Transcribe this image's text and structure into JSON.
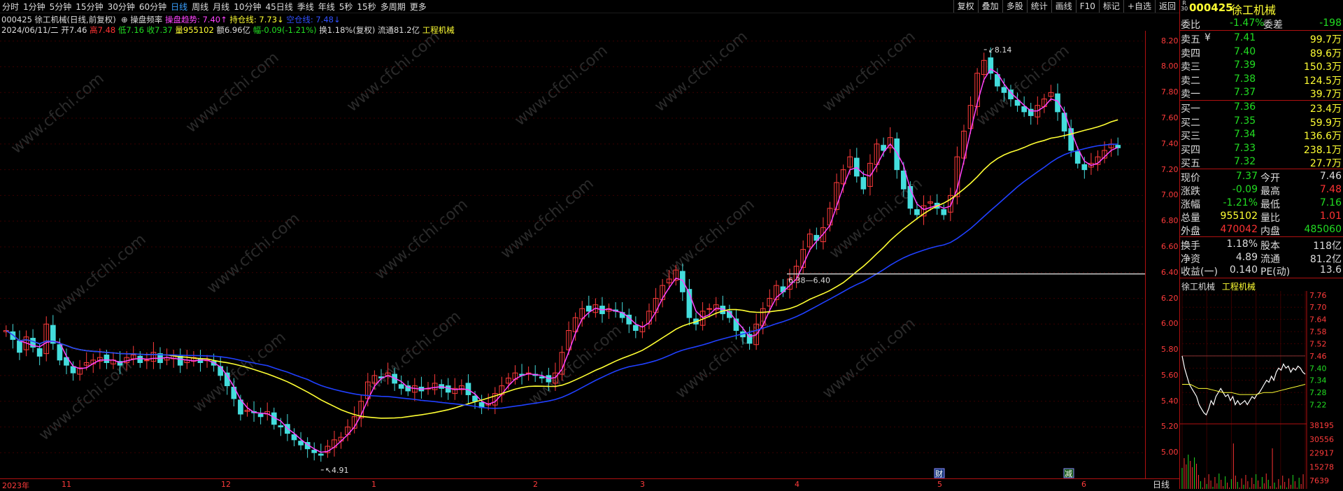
{
  "toolbar": {
    "timeframes": [
      "分时",
      "1分钟",
      "5分钟",
      "15分钟",
      "30分钟",
      "60分钟",
      "日线",
      "周线",
      "月线",
      "10分钟",
      "45日线",
      "季线",
      "年线",
      "5秒",
      "15秒",
      "多周期",
      "更多"
    ],
    "active": "日线",
    "tools": [
      "复权",
      "叠加",
      "多股",
      "统计",
      "画线",
      "F10",
      "标记",
      "+自选",
      "返回"
    ]
  },
  "info": {
    "line1": {
      "code_name": "000425 徐工机械(日线,前复权)",
      "indicator": "操盘频率",
      "trend_label": "操盘趋势: 7.40↑",
      "hold_label": "持仓线: 7.73↓",
      "stop_label": "空仓线: 7.48↓"
    },
    "line2": {
      "date": "2024/06/11/二",
      "open": "开7.46",
      "high": "高7.48",
      "low": "低7.16",
      "close": "收7.37",
      "vol": "量955102",
      "amt": "额6.96亿",
      "chg": "幅-0.09(-1.21%)",
      "turn": "换1.18%(复权)",
      "float": "流通81.2亿",
      "industry": "工程机械"
    }
  },
  "chart_data": {
    "type": "candlestick",
    "y_ticks": [
      "8.20",
      "8.00",
      "7.80",
      "7.60",
      "7.40",
      "7.20",
      "7.00",
      "6.80",
      "6.60",
      "6.40",
      "6.20",
      "6.00",
      "5.80",
      "5.60",
      "5.40",
      "5.20",
      "5.00"
    ],
    "ylim": [
      4.8,
      8.28
    ],
    "x_labels": [
      "2023年",
      "11",
      "12",
      "1",
      "2",
      "3",
      "4",
      "5",
      "6"
    ],
    "annotations": [
      "8.14",
      "4.91",
      "6.38—6.40"
    ],
    "markers": [
      "财",
      "减"
    ],
    "hline": 6.39,
    "closes": [
      5.95,
      5.88,
      5.78,
      5.9,
      5.82,
      5.75,
      6.0,
      5.85,
      5.72,
      5.68,
      5.62,
      5.66,
      5.7,
      5.72,
      5.74,
      5.7,
      5.72,
      5.68,
      5.74,
      5.76,
      5.7,
      5.72,
      5.78,
      5.7,
      5.74,
      5.76,
      5.68,
      5.72,
      5.74,
      5.7,
      5.72,
      5.68,
      5.6,
      5.52,
      5.42,
      5.3,
      5.33,
      5.31,
      5.28,
      5.32,
      5.22,
      5.2,
      5.15,
      5.1,
      5.06,
      5.03,
      5.0,
      4.98,
      5.05,
      5.1,
      5.12,
      5.2,
      5.28,
      5.4,
      5.55,
      5.6,
      5.58,
      5.62,
      5.54,
      5.5,
      5.48,
      5.52,
      5.48,
      5.5,
      5.54,
      5.5,
      5.47,
      5.5,
      5.52,
      5.45,
      5.4,
      5.35,
      5.38,
      5.46,
      5.52,
      5.58,
      5.62,
      5.6,
      5.62,
      5.6,
      5.58,
      5.55,
      5.62,
      5.78,
      5.95,
      6.05,
      6.12,
      6.1,
      6.15,
      6.08,
      6.12,
      6.1,
      6.05,
      6.0,
      5.95,
      5.98,
      6.1,
      6.2,
      6.3,
      6.35,
      6.42,
      6.25,
      6.05,
      6.0,
      6.1,
      6.12,
      6.15,
      6.08,
      6.05,
      5.95,
      5.9,
      5.85,
      6.0,
      6.12,
      6.2,
      6.3,
      6.25,
      6.35,
      6.45,
      6.58,
      6.7,
      6.65,
      6.75,
      6.9,
      7.1,
      7.2,
      7.3,
      7.15,
      7.05,
      7.25,
      7.4,
      7.35,
      7.45,
      7.2,
      7.05,
      6.9,
      6.85,
      6.92,
      6.95,
      6.9,
      6.85,
      7.0,
      7.3,
      7.5,
      7.7,
      7.95,
      8.05,
      7.95,
      7.85,
      7.8,
      7.75,
      7.7,
      7.65,
      7.62,
      7.7,
      7.75,
      7.8,
      7.65,
      7.5,
      7.35,
      7.25,
      7.2,
      7.25,
      7.3,
      7.35,
      7.4,
      7.37
    ],
    "series": [
      {
        "name": "操盘趋势",
        "color": "#ff44ff",
        "ma": 3
      },
      {
        "name": "持仓线",
        "color": "#ffff33",
        "ma": 25
      },
      {
        "name": "空仓线",
        "color": "#2040ff",
        "ma": 40
      }
    ]
  },
  "panel": {
    "header": {
      "code": "000425",
      "name": "徐工机械",
      "badge_top": "R",
      "badge_bottom": "30"
    },
    "wei": {
      "label1": "委比",
      "val1": "-1.47%",
      "label2": "委差",
      "val2": "-198"
    },
    "asks": [
      {
        "label": "卖五",
        "tag": "¥",
        "price": "7.41",
        "vol": "99.7万"
      },
      {
        "label": "卖四",
        "tag": "",
        "price": "7.40",
        "vol": "89.6万"
      },
      {
        "label": "卖三",
        "tag": "",
        "price": "7.39",
        "vol": "150.3万"
      },
      {
        "label": "卖二",
        "tag": "",
        "price": "7.38",
        "vol": "124.5万"
      },
      {
        "label": "卖一",
        "tag": "",
        "price": "7.37",
        "vol": "39.7万"
      }
    ],
    "bids": [
      {
        "label": "买一",
        "price": "7.36",
        "vol": "23.4万"
      },
      {
        "label": "买二",
        "price": "7.35",
        "vol": "59.9万"
      },
      {
        "label": "买三",
        "price": "7.34",
        "vol": "136.6万"
      },
      {
        "label": "买四",
        "price": "7.33",
        "vol": "238.1万"
      },
      {
        "label": "买五",
        "price": "7.32",
        "vol": "27.7万"
      }
    ],
    "quote": [
      {
        "l1": "现价",
        "v1": "7.37",
        "l2": "今开",
        "v2": "7.46"
      },
      {
        "l1": "涨跌",
        "v1": "-0.09",
        "l2": "最高",
        "v2": "7.48"
      },
      {
        "l1": "涨幅",
        "v1": "-1.21%",
        "l2": "最低",
        "v2": "7.16"
      },
      {
        "l1": "总量",
        "v1": "955102",
        "l2": "量比",
        "v2": "1.01"
      },
      {
        "l1": "外盘",
        "v1": "470042",
        "l2": "内盘",
        "v2": "485060"
      }
    ],
    "fund": [
      {
        "l1": "换手",
        "v1": "1.18%",
        "l2": "股本",
        "v2": "118亿"
      },
      {
        "l1": "净资",
        "v1": "4.89",
        "l2": "流通",
        "v2": "81.2亿"
      },
      {
        "l1": "收益(一)",
        "v1": "0.140",
        "l2": "PE(动)",
        "v2": "13.6"
      }
    ],
    "mini": {
      "title": "徐工机械",
      "industry": "工程机械",
      "price_ticks": [
        "7.76",
        "7.70",
        "7.64",
        "7.58",
        "7.52",
        "7.46",
        "7.40",
        "7.34",
        "7.28",
        "7.22"
      ],
      "vol_ticks": [
        "38195",
        "30556",
        "22917",
        "15278",
        "7639"
      ],
      "ylim": [
        7.16,
        7.78
      ],
      "prices": [
        7.46,
        7.4,
        7.36,
        7.32,
        7.3,
        7.28,
        7.26,
        7.22,
        7.2,
        7.18,
        7.17,
        7.2,
        7.24,
        7.22,
        7.26,
        7.28,
        7.3,
        7.28,
        7.26,
        7.27,
        7.24,
        7.26,
        7.22,
        7.24,
        7.22,
        7.23,
        7.24,
        7.22,
        7.24,
        7.26,
        7.25,
        7.27,
        7.28,
        7.3,
        7.32,
        7.34,
        7.33,
        7.36,
        7.34,
        7.38,
        7.4,
        7.39,
        7.42,
        7.4,
        7.41,
        7.38,
        7.4,
        7.39,
        7.41,
        7.4,
        7.38,
        7.37
      ],
      "avg": [
        7.32,
        7.32,
        7.3,
        7.3,
        7.29,
        7.28,
        7.28,
        7.27,
        7.27,
        7.27,
        7.28,
        7.28,
        7.29,
        7.3,
        7.31,
        7.32
      ]
    }
  },
  "watermark": "www.cfchi.com"
}
